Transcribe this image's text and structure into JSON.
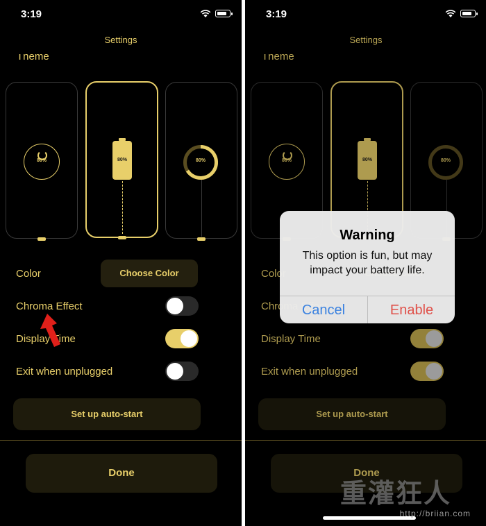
{
  "status": {
    "time": "3:19"
  },
  "nav": {
    "title": "Settings"
  },
  "theme": {
    "label": "Theme",
    "cards": [
      {
        "percent": "80%",
        "style": "ring"
      },
      {
        "percent": "80%",
        "style": "battery",
        "selected": true
      },
      {
        "percent": "80%",
        "style": "arc"
      }
    ]
  },
  "settings": {
    "color_label": "Color",
    "choose_color_label": "Choose Color",
    "chroma_label": "Chroma Effect",
    "chroma_on": false,
    "display_time_label": "Display Time",
    "display_time_on": true,
    "exit_label": "Exit when unplugged",
    "exit_on": false,
    "autostart_label": "Set up auto-start",
    "done_label": "Done"
  },
  "alert": {
    "title": "Warning",
    "message": "This option is fun, but may impact your battery life.",
    "cancel_label": "Cancel",
    "enable_label": "Enable"
  },
  "watermark": {
    "title": "重灌狂人",
    "url": "http://briian.com"
  },
  "colors": {
    "accent": "#e8cf6a",
    "background": "#000000",
    "alert_cancel": "#3b82e0",
    "alert_enable": "#e0514a"
  }
}
